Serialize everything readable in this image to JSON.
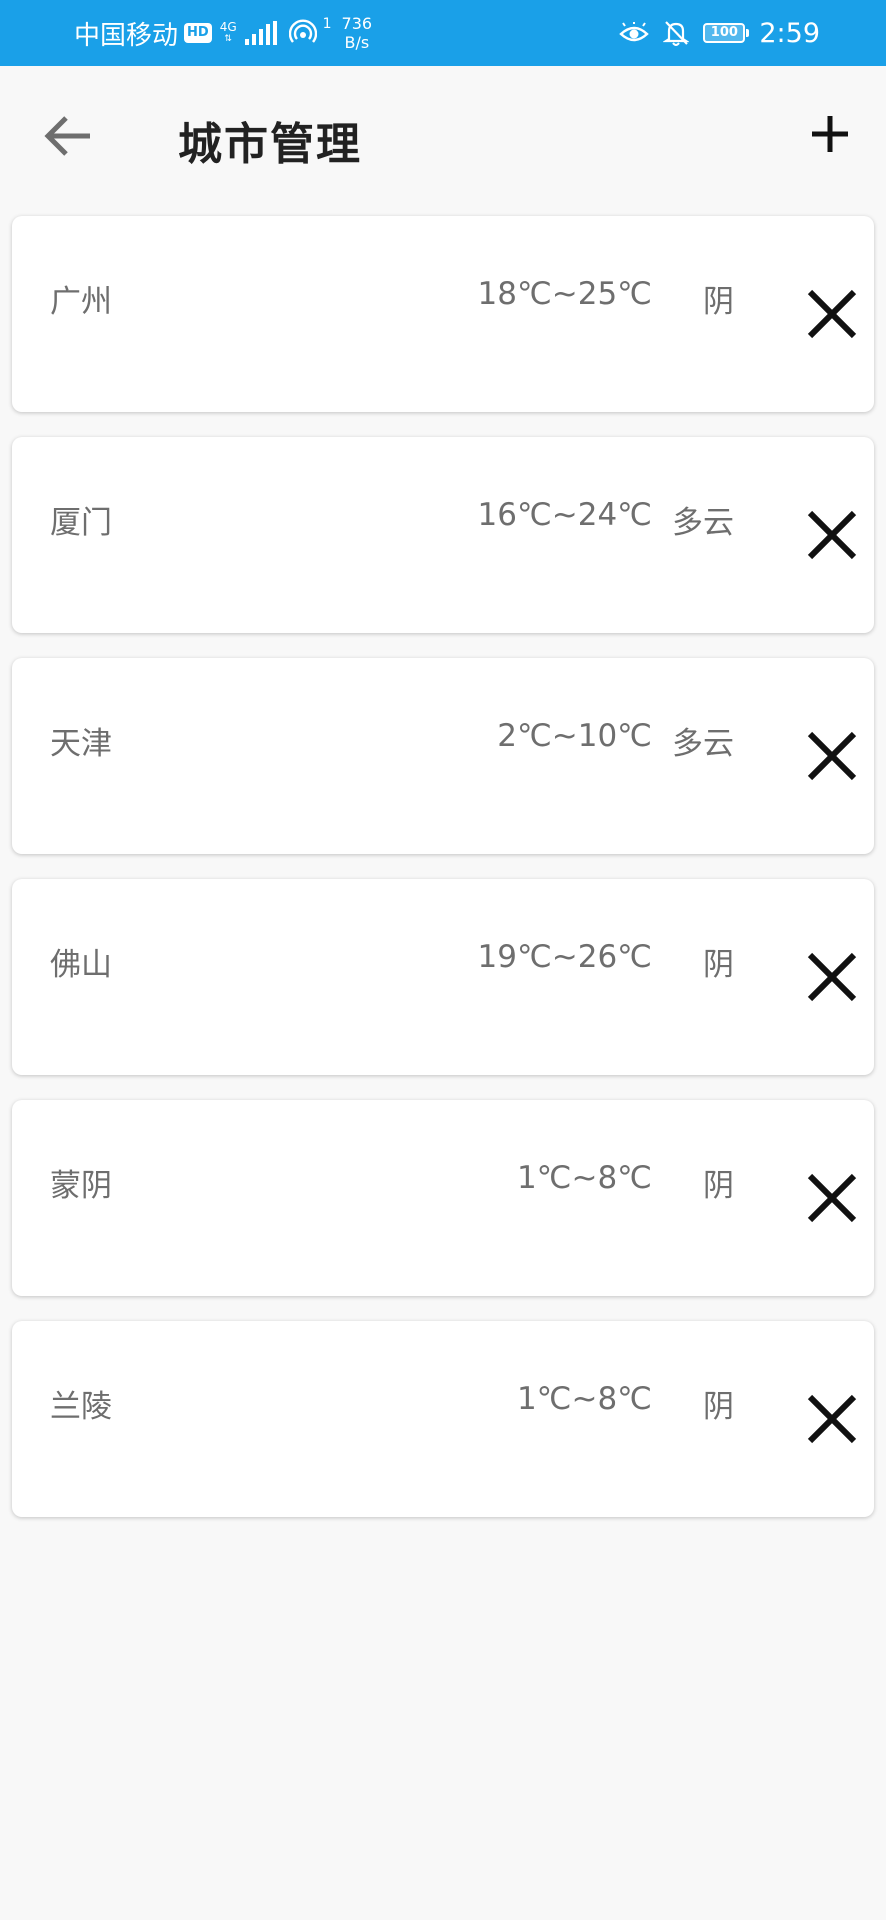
{
  "status_bar": {
    "carrier": "中国移动",
    "hd": "HD",
    "net_type": "4G",
    "hotspot_count": "1",
    "speed_value": "736",
    "speed_unit": "B/s",
    "battery": "100",
    "time": "2:59"
  },
  "header": {
    "title": "城市管理",
    "back_icon": "arrow-left-icon",
    "add_icon": "plus-icon"
  },
  "cities": [
    {
      "name": "广州",
      "temp": "18℃~25℃",
      "weather": "阴"
    },
    {
      "name": "厦门",
      "temp": "16℃~24℃",
      "weather": "多云"
    },
    {
      "name": "天津",
      "temp": "2℃~10℃",
      "weather": "多云"
    },
    {
      "name": "佛山",
      "temp": "19℃~26℃",
      "weather": "阴"
    },
    {
      "name": "蒙阴",
      "temp": "1℃~8℃",
      "weather": "阴"
    },
    {
      "name": "兰陵",
      "temp": "1℃~8℃",
      "weather": "阴"
    }
  ],
  "colors": {
    "status_bar": "#1aa0e8",
    "background": "#f8f8f8",
    "card": "#ffffff",
    "secondary_text": "#6e6e6e"
  }
}
